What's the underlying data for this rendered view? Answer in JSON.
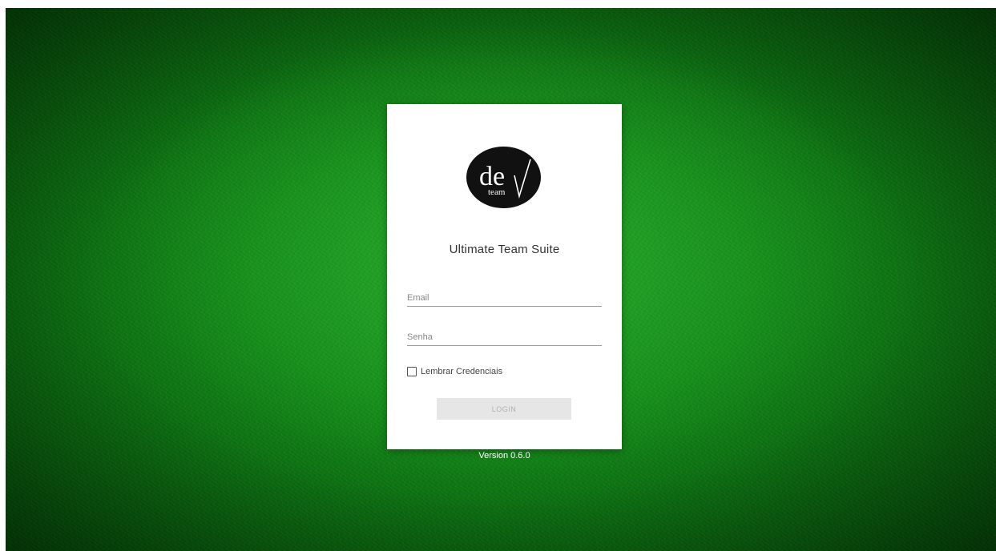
{
  "app": {
    "title": "Ultimate Team Suite",
    "version": "Version 0.6.0"
  },
  "logo": {
    "text_main": "de",
    "text_sub": "team",
    "icon": "checkmark-icon"
  },
  "form": {
    "email_placeholder": "Email",
    "email_value": "",
    "password_placeholder": "Senha",
    "password_value": "",
    "remember_label": "Lembrar Credenciais",
    "remember_checked": false,
    "login_label": "LOGIN"
  },
  "colors": {
    "background": "#138a18",
    "card": "#ffffff",
    "button_disabled": "#e6e6e6",
    "button_text_disabled": "#b0b0b0"
  }
}
